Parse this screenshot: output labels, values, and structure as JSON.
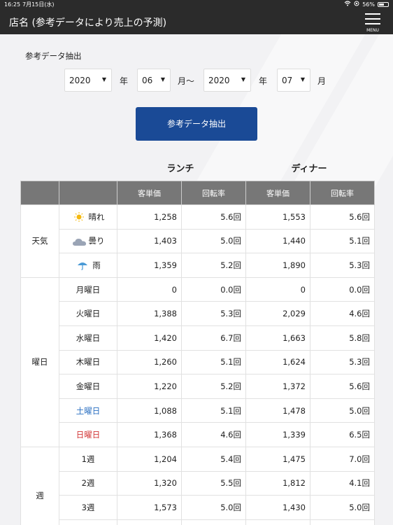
{
  "status": {
    "time": "16:25",
    "date": "7月15日(水)",
    "battery": "56%",
    "battery_level": 0.56
  },
  "header": {
    "title": "店名 (参考データにより売上の予測)",
    "menu_label": "MENU"
  },
  "extract": {
    "label": "参考データ抽出",
    "from_year": "2020",
    "year_unit": "年",
    "from_month": "06",
    "from_month_unit": "月〜",
    "to_year": "2020",
    "to_year_unit": "年",
    "to_month": "07",
    "to_month_unit": "月",
    "button": "参考データ抽出"
  },
  "table": {
    "groups": {
      "lunch": "ランチ",
      "dinner": "ディナー"
    },
    "columns": {
      "price": "客単価",
      "turnover": "回転率"
    },
    "categories": {
      "weather": "天気",
      "weekday": "曜日",
      "week": "週"
    },
    "rows": [
      {
        "label": "晴れ",
        "icon": "sun-icon",
        "lp": "1,258",
        "lt": "5.6回",
        "dp": "1,553",
        "dt": "5.6回"
      },
      {
        "label": "曇り",
        "icon": "cloud-icon",
        "lp": "1,403",
        "lt": "5.0回",
        "dp": "1,440",
        "dt": "5.1回"
      },
      {
        "label": "雨",
        "icon": "umbrella-icon",
        "lp": "1,359",
        "lt": "5.2回",
        "dp": "1,890",
        "dt": "5.3回"
      },
      {
        "label": "月曜日",
        "lp": "0",
        "lt": "0.0回",
        "dp": "0",
        "dt": "0.0回"
      },
      {
        "label": "火曜日",
        "lp": "1,388",
        "lt": "5.3回",
        "dp": "2,029",
        "dt": "4.6回"
      },
      {
        "label": "水曜日",
        "lp": "1,420",
        "lt": "6.7回",
        "dp": "1,663",
        "dt": "5.8回"
      },
      {
        "label": "木曜日",
        "lp": "1,260",
        "lt": "5.1回",
        "dp": "1,624",
        "dt": "5.3回"
      },
      {
        "label": "金曜日",
        "lp": "1,220",
        "lt": "5.2回",
        "dp": "1,372",
        "dt": "5.6回"
      },
      {
        "label": "土曜日",
        "lp": "1,088",
        "lt": "5.1回",
        "dp": "1,478",
        "dt": "5.0回"
      },
      {
        "label": "日曜日",
        "lp": "1,368",
        "lt": "4.6回",
        "dp": "1,339",
        "dt": "6.5回"
      },
      {
        "label": "1週",
        "lp": "1,204",
        "lt": "5.4回",
        "dp": "1,475",
        "dt": "7.0回"
      },
      {
        "label": "2週",
        "lp": "1,320",
        "lt": "5.5回",
        "dp": "1,812",
        "dt": "4.1回"
      },
      {
        "label": "3週",
        "lp": "1,573",
        "lt": "5.0回",
        "dp": "1,430",
        "dt": "5.0回"
      }
    ]
  },
  "colors": {
    "header_bg": "#2b2b2b",
    "button_bg": "#1a4a96",
    "table_header_bg": "#777777",
    "saturday": "#2a6fc1",
    "sunday": "#d23333"
  }
}
